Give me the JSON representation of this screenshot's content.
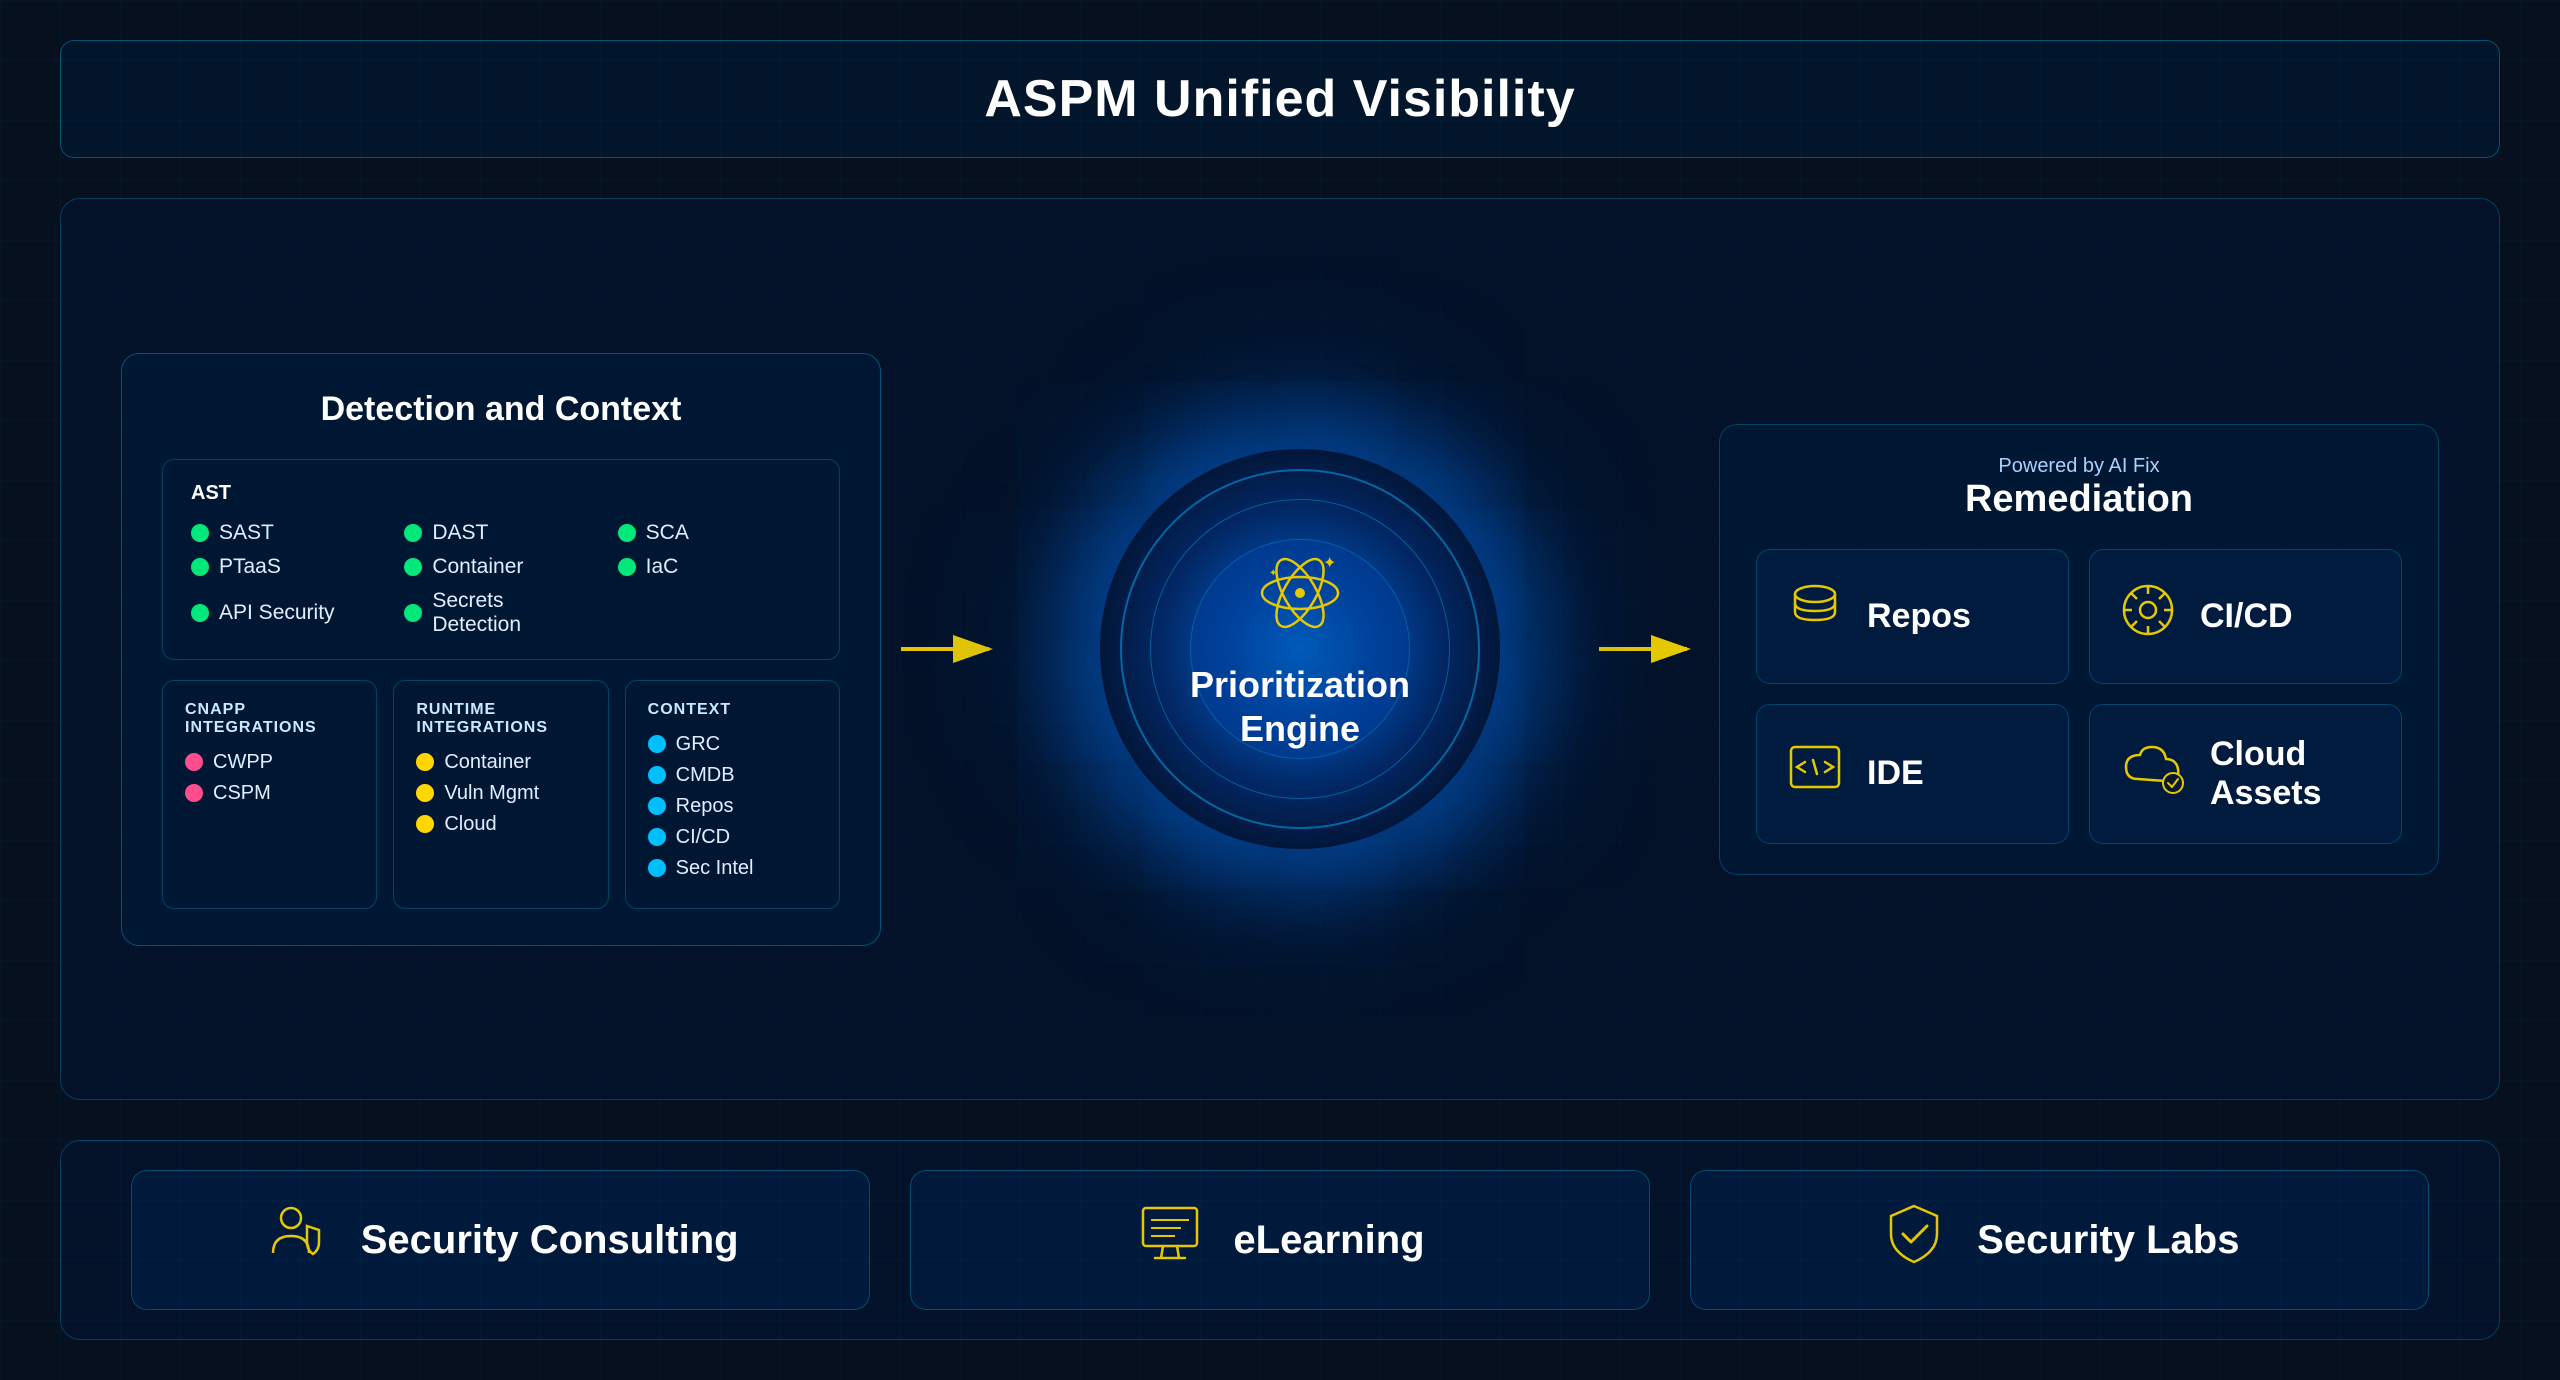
{
  "title": "ASPM Unified Visibility",
  "detection": {
    "heading": "Detection and Context",
    "ast_label": "AST",
    "ast_items": [
      {
        "label": "SAST",
        "color": "green"
      },
      {
        "label": "DAST",
        "color": "green"
      },
      {
        "label": "SCA",
        "color": "green"
      },
      {
        "label": "PTaaS",
        "color": "green"
      },
      {
        "label": "Container",
        "color": "green"
      },
      {
        "label": "IaC",
        "color": "green"
      },
      {
        "label": "API Security",
        "color": "green"
      },
      {
        "label": "Secrets Detection",
        "color": "green"
      }
    ],
    "cnapp_title": "CNAPP INTEGRATIONS",
    "cnapp_items": [
      {
        "label": "CWPP",
        "color": "pink"
      },
      {
        "label": "CSPM",
        "color": "pink"
      }
    ],
    "runtime_title": "RUNTIME INTEGRATIONS",
    "runtime_items": [
      {
        "label": "Container",
        "color": "yellow"
      },
      {
        "label": "Vuln Mgmt",
        "color": "yellow"
      },
      {
        "label": "Cloud",
        "color": "yellow"
      }
    ],
    "context_title": "CONTEXT",
    "context_items": [
      {
        "label": "GRC",
        "color": "blue"
      },
      {
        "label": "CMDB",
        "color": "blue"
      },
      {
        "label": "Repos",
        "color": "blue"
      },
      {
        "label": "CI/CD",
        "color": "blue"
      },
      {
        "label": "Sec Intel",
        "color": "blue"
      }
    ]
  },
  "engine": {
    "label_line1": "Prioritization",
    "label_line2": "Engine"
  },
  "remediation": {
    "subtitle": "Powered by AI Fix",
    "heading": "Remediation",
    "cards": [
      {
        "label": "Repos",
        "icon": "database"
      },
      {
        "label": "CI/CD",
        "icon": "gear"
      },
      {
        "label": "IDE",
        "icon": "code"
      },
      {
        "label": "Cloud Assets",
        "icon": "cloud-gear"
      }
    ]
  },
  "bottom": {
    "cards": [
      {
        "label": "Security Consulting",
        "icon": "person-shield"
      },
      {
        "label": "eLearning",
        "icon": "monitor-book"
      },
      {
        "label": "Security Labs",
        "icon": "shield-check"
      }
    ]
  },
  "arrows": {
    "left": "→",
    "right": "→"
  }
}
